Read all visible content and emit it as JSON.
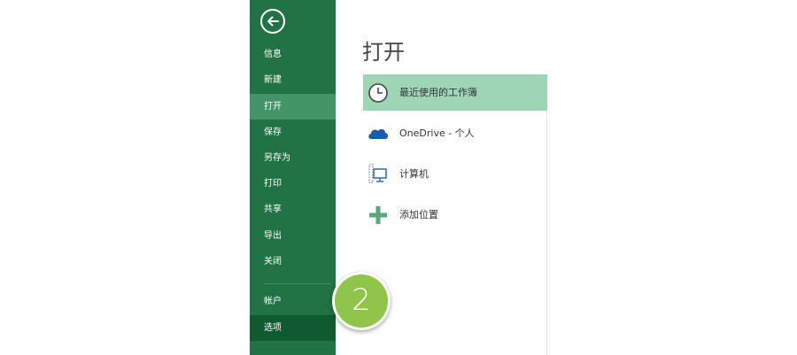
{
  "sidebar": {
    "back_icon": "back-arrow-icon",
    "items": [
      {
        "label": "信息"
      },
      {
        "label": "新建"
      },
      {
        "label": "打开"
      },
      {
        "label": "保存"
      },
      {
        "label": "另存为"
      },
      {
        "label": "打印"
      },
      {
        "label": "共享"
      },
      {
        "label": "导出"
      },
      {
        "label": "关闭"
      },
      {
        "label": "帐户"
      },
      {
        "label": "选项"
      }
    ],
    "active_item": "打开",
    "colors": {
      "background": "#217346",
      "active": "#439467",
      "options_highlight": "#0f5a30"
    }
  },
  "main": {
    "title": "打开",
    "locations": [
      {
        "label": "最近使用的工作簿",
        "icon": "clock-icon"
      },
      {
        "label": "OneDrive - 个人",
        "icon": "cloud-icon"
      },
      {
        "label": "计算机",
        "icon": "computer-icon"
      },
      {
        "label": "添加位置",
        "icon": "plus-icon"
      }
    ],
    "selected_location": "最近使用的工作簿",
    "selected_color": "#9fd5b7"
  },
  "step_badge": {
    "number": "2",
    "color": "#8fc54b"
  }
}
